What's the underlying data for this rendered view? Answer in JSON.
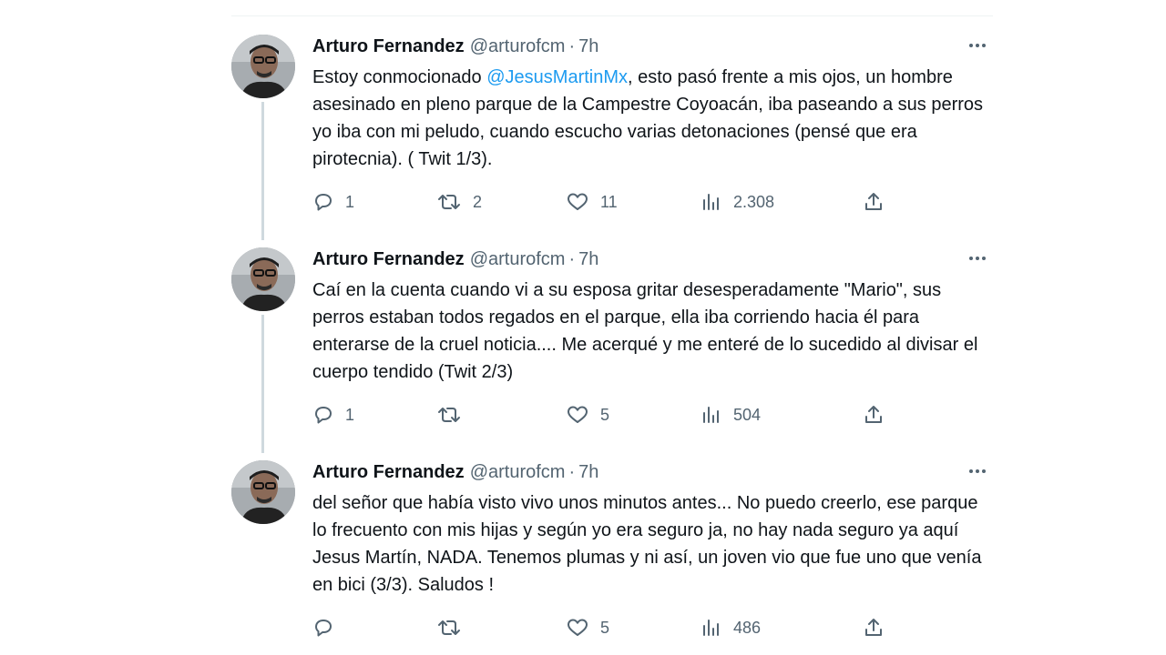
{
  "tweets": [
    {
      "author_name": "Arturo Fernandez",
      "author_handle": "@arturofcm",
      "separator": "·",
      "time": "7h",
      "text_before_mention": "Estoy conmocionado ",
      "mention": "@JesusMartinMx",
      "text_after_mention": ", esto pasó frente a mis ojos, un hombre asesinado en pleno parque de la Campestre Coyoacán, iba paseando a sus perros yo iba con mi peludo, cuando escucho varias detonaciones (pensé que era pirotecnia). ( Twit 1/3).",
      "replies": "1",
      "retweets": "2",
      "likes": "11",
      "views": "2.308"
    },
    {
      "author_name": "Arturo Fernandez",
      "author_handle": "@arturofcm",
      "separator": "·",
      "time": "7h",
      "text": "Caí en la cuenta cuando vi a su esposa gritar desesperadamente \"Mario\", sus perros estaban todos regados en el parque, ella iba corriendo hacia él para enterarse de la cruel noticia.... Me acerqué y me enteré de lo sucedido al divisar el cuerpo tendido  (Twit 2/3)",
      "replies": "1",
      "retweets": "",
      "likes": "5",
      "views": "504"
    },
    {
      "author_name": "Arturo Fernandez",
      "author_handle": "@arturofcm",
      "separator": "·",
      "time": "7h",
      "text": "del señor que había visto vivo unos minutos antes... No puedo creerlo, ese parque lo frecuento con mis hijas y según yo era seguro ja, no hay nada seguro ya aquí Jesus Martín, NADA. Tenemos plumas y ni así, un joven vio que fue uno que venía en bici (3/3). Saludos !",
      "replies": "",
      "retweets": "",
      "likes": "5",
      "views": "486"
    }
  ],
  "icons": {
    "reply": "speech-bubble-icon",
    "retweet": "retweet-arrows-icon",
    "like": "heart-icon",
    "views": "bar-chart-icon",
    "share": "share-upload-icon",
    "more": "more-dots-icon"
  },
  "colors": {
    "mention": "#1d9bf0",
    "secondary_text": "#536471",
    "thread_line": "#cfd9de"
  }
}
